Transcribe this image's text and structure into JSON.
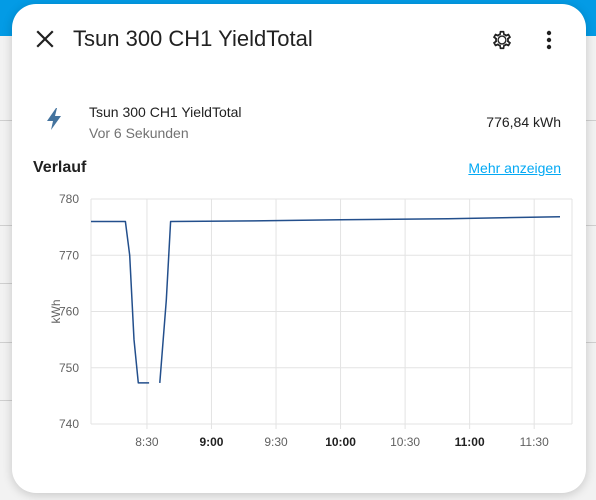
{
  "dialog": {
    "title": "Tsun 300 CH1 YieldTotal",
    "close_icon": "close-icon",
    "settings_icon": "gear-icon",
    "more_icon": "more-vertical-icon"
  },
  "entity": {
    "icon": "lightning-bolt-icon",
    "name": "Tsun 300 CH1 YieldTotal",
    "last_changed": "Vor 6 Sekunden",
    "value": "776,84 kWh"
  },
  "history": {
    "title": "Verlauf",
    "show_more": "Mehr anzeigen"
  },
  "colors": {
    "accent": "#03a9f4",
    "header_bg": "#039be5",
    "line": "#234f8c",
    "icon": "#44739e"
  },
  "chart_data": {
    "type": "line",
    "ylabel": "kWh",
    "ylim": [
      740,
      780
    ],
    "y_ticks": [
      "740",
      "750",
      "760",
      "770",
      "780"
    ],
    "x_ticks": [
      {
        "t": 510,
        "label": "8:30",
        "bold": false
      },
      {
        "t": 540,
        "label": "9:00",
        "bold": true
      },
      {
        "t": 570,
        "label": "9:30",
        "bold": false
      },
      {
        "t": 600,
        "label": "10:00",
        "bold": true
      },
      {
        "t": 630,
        "label": "10:30",
        "bold": false
      },
      {
        "t": 660,
        "label": "11:00",
        "bold": true
      },
      {
        "t": 690,
        "label": "11:30",
        "bold": false
      }
    ],
    "x_range_minutes": [
      484,
      702
    ],
    "grid": true,
    "series": [
      {
        "segments": [
          [
            [
              484,
              776.0
            ],
            [
              500,
              776.0
            ],
            [
              502,
              770.0
            ],
            [
              504,
              755.0
            ],
            [
              506,
              747.3
            ],
            [
              511,
              747.3
            ]
          ],
          [
            [
              516,
              747.3
            ],
            [
              519,
              762.0
            ],
            [
              521,
              776.0
            ],
            [
              560,
              776.1
            ],
            [
              600,
              776.3
            ],
            [
              650,
              776.5
            ],
            [
              702,
              776.84
            ]
          ]
        ]
      }
    ]
  }
}
